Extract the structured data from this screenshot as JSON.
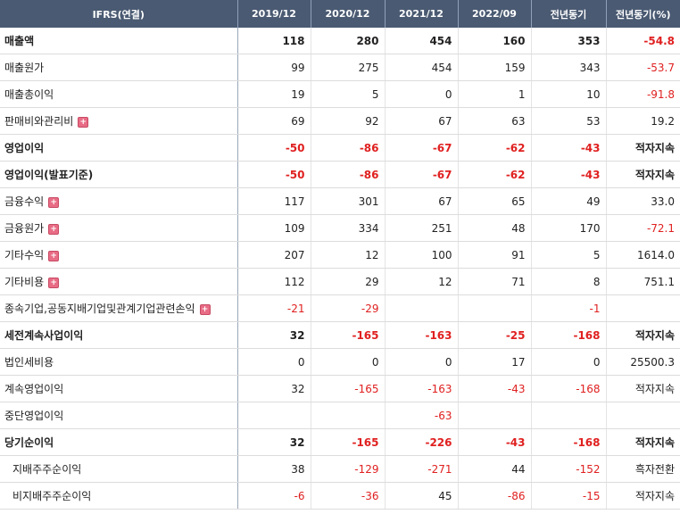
{
  "header": {
    "label": "IFRS(연결)",
    "columns": [
      "2019/12",
      "2020/12",
      "2021/12",
      "2022/09",
      "전년동기",
      "전년동기(%)"
    ]
  },
  "rows": [
    {
      "label": "매출액",
      "bold": true,
      "expandable": false,
      "indent": false,
      "values": [
        "118",
        "280",
        "454",
        "160",
        "353",
        "-54.8"
      ]
    },
    {
      "label": "매출원가",
      "bold": false,
      "expandable": false,
      "indent": false,
      "values": [
        "99",
        "275",
        "454",
        "159",
        "343",
        "-53.7"
      ]
    },
    {
      "label": "매출총이익",
      "bold": false,
      "expandable": false,
      "indent": false,
      "values": [
        "19",
        "5",
        "0",
        "1",
        "10",
        "-91.8"
      ]
    },
    {
      "label": "판매비와관리비",
      "bold": false,
      "expandable": true,
      "indent": false,
      "values": [
        "69",
        "92",
        "67",
        "63",
        "53",
        "19.2"
      ]
    },
    {
      "label": "영업이익",
      "bold": true,
      "expandable": false,
      "indent": false,
      "values": [
        "-50",
        "-86",
        "-67",
        "-62",
        "-43",
        "적자지속"
      ]
    },
    {
      "label": "영업이익(발표기준)",
      "bold": true,
      "expandable": false,
      "indent": false,
      "values": [
        "-50",
        "-86",
        "-67",
        "-62",
        "-43",
        "적자지속"
      ]
    },
    {
      "label": "금융수익",
      "bold": false,
      "expandable": true,
      "indent": false,
      "values": [
        "117",
        "301",
        "67",
        "65",
        "49",
        "33.0"
      ]
    },
    {
      "label": "금융원가",
      "bold": false,
      "expandable": true,
      "indent": false,
      "values": [
        "109",
        "334",
        "251",
        "48",
        "170",
        "-72.1"
      ]
    },
    {
      "label": "기타수익",
      "bold": false,
      "expandable": true,
      "indent": false,
      "values": [
        "207",
        "12",
        "100",
        "91",
        "5",
        "1614.0"
      ]
    },
    {
      "label": "기타비용",
      "bold": false,
      "expandable": true,
      "indent": false,
      "values": [
        "112",
        "29",
        "12",
        "71",
        "8",
        "751.1"
      ]
    },
    {
      "label": "종속기업,공동지배기업및관계기업관련손익",
      "bold": false,
      "expandable": true,
      "indent": false,
      "values": [
        "-21",
        "-29",
        "",
        "",
        "-1",
        ""
      ]
    },
    {
      "label": "세전계속사업이익",
      "bold": true,
      "expandable": false,
      "indent": false,
      "values": [
        "32",
        "-165",
        "-163",
        "-25",
        "-168",
        "적자지속"
      ]
    },
    {
      "label": "법인세비용",
      "bold": false,
      "expandable": false,
      "indent": false,
      "values": [
        "0",
        "0",
        "0",
        "17",
        "0",
        "25500.3"
      ]
    },
    {
      "label": "계속영업이익",
      "bold": false,
      "expandable": false,
      "indent": false,
      "values": [
        "32",
        "-165",
        "-163",
        "-43",
        "-168",
        "적자지속"
      ]
    },
    {
      "label": "중단영업이익",
      "bold": false,
      "expandable": false,
      "indent": false,
      "values": [
        "",
        "",
        "-63",
        "",
        "",
        ""
      ]
    },
    {
      "label": "당기순이익",
      "bold": true,
      "expandable": false,
      "indent": false,
      "values": [
        "32",
        "-165",
        "-226",
        "-43",
        "-168",
        "적자지속"
      ]
    },
    {
      "label": "지배주주순이익",
      "bold": false,
      "expandable": false,
      "indent": true,
      "values": [
        "38",
        "-129",
        "-271",
        "44",
        "-152",
        "흑자전환"
      ]
    },
    {
      "label": "비지배주주순이익",
      "bold": false,
      "expandable": false,
      "indent": true,
      "values": [
        "-6",
        "-36",
        "45",
        "-86",
        "-15",
        "적자지속"
      ]
    }
  ],
  "expand_icon": "plus-icon",
  "colors": {
    "header_bg": "#4a5a72",
    "negative": "#e02020",
    "expand_icon": "#e86c85"
  }
}
